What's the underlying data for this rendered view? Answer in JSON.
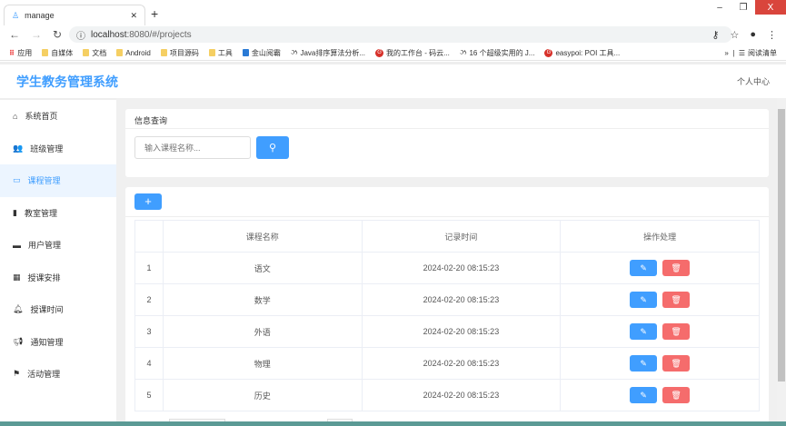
{
  "browser": {
    "tab_title": "manage",
    "url_host": "localhost",
    "url_rest": ":8080/#/projects",
    "bookmarks": [
      "应用",
      "自媒体",
      "文档",
      "Android",
      "项目源码",
      "工具",
      "金山阅霸",
      "Java排序算法分析...",
      "我的工作台 - 码云...",
      "16 个超级实用的 J...",
      "easypoi: POI 工具..."
    ],
    "reading_list": "阅读清单"
  },
  "app": {
    "title": "学生教务管理系统",
    "user_menu": "个人中心"
  },
  "sidebar": {
    "items": [
      {
        "label": "系统首页",
        "icon": "home-icon"
      },
      {
        "label": "班级管理",
        "icon": "users-icon"
      },
      {
        "label": "课程管理",
        "icon": "calendar-icon"
      },
      {
        "label": "教室管理",
        "icon": "building-icon"
      },
      {
        "label": "用户管理",
        "icon": "id-card-icon"
      },
      {
        "label": "授课安排",
        "icon": "schedule-icon"
      },
      {
        "label": "授课时间",
        "icon": "bell-icon"
      },
      {
        "label": "通知管理",
        "icon": "megaphone-icon"
      },
      {
        "label": "活动管理",
        "icon": "flag-icon"
      }
    ],
    "active": 2
  },
  "query": {
    "title": "信息查询",
    "placeholder": "输入课程名称..."
  },
  "table": {
    "headers": [
      "",
      "课程名称",
      "记录时间",
      "操作处理"
    ],
    "rows": [
      [
        "1",
        "语文",
        "2024-02-20 08:15:23"
      ],
      [
        "2",
        "数学",
        "2024-02-20 08:15:23"
      ],
      [
        "3",
        "外语",
        "2024-02-20 08:15:23"
      ],
      [
        "4",
        "物理",
        "2024-02-20 08:15:23"
      ],
      [
        "5",
        "历史",
        "2024-02-20 08:15:23"
      ]
    ]
  },
  "colors": {
    "primary": "#409eff",
    "danger": "#f56c6c"
  }
}
